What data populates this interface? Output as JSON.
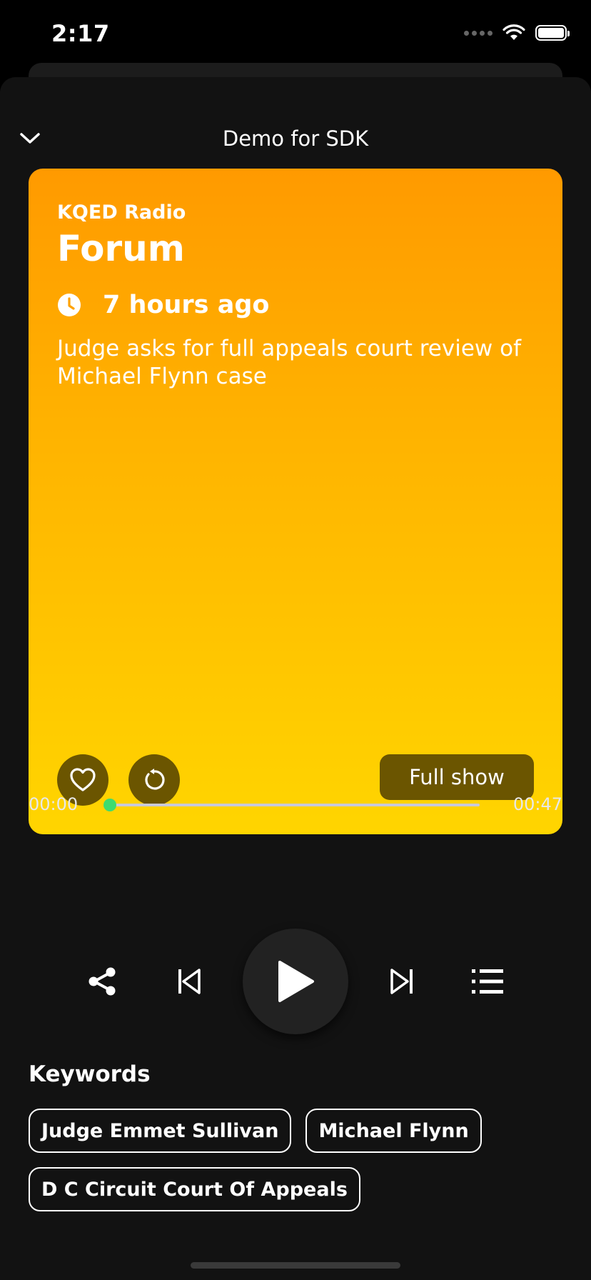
{
  "status_bar": {
    "time": "2:17"
  },
  "header": {
    "title": "Demo for SDK"
  },
  "card": {
    "station": "KQED Radio",
    "show": "Forum",
    "time_ago": "7 hours ago",
    "headline": "Judge asks for full appeals court review of Michael Flynn case",
    "full_show_label": "Full show",
    "gradient_top": "#ff9a00",
    "gradient_bottom": "#ffd500"
  },
  "player": {
    "current_time": "00:00",
    "duration": "00:47",
    "progress": 0,
    "accent": "#3ddc6f"
  },
  "keywords": {
    "title": "Keywords",
    "items": [
      "Judge Emmet Sullivan",
      "Michael Flynn",
      "D C Circuit Court Of Appeals"
    ]
  },
  "icons": {
    "collapse": "chevron-down-icon",
    "favorite": "heart-icon",
    "replay": "replay-icon",
    "share": "share-icon",
    "previous": "skip-previous-icon",
    "play": "play-icon",
    "next": "skip-next-icon",
    "queue": "list-icon",
    "time": "clock-icon"
  }
}
